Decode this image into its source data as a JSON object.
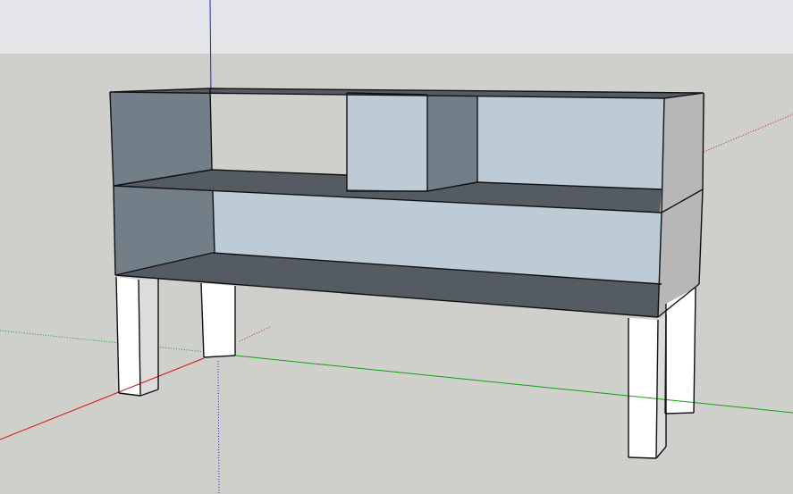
{
  "app": {
    "type": "3d-modeling-viewport",
    "view": "perspective"
  },
  "scene": {
    "object": "shelving-unit",
    "components": [
      "top-panel",
      "middle-shelf",
      "bottom-shelf",
      "back-panel",
      "left-side-panel",
      "right-side-panel",
      "center-cubby",
      "four-legs"
    ]
  },
  "colors": {
    "sky": "#e3e5e8",
    "ground": "#cfcfcb",
    "axis_red": "#d11616",
    "axis_green": "#12a012",
    "axis_blue": "#2323d6",
    "back_panel": "#bccbd5",
    "side_panel_dark": "#737f88",
    "shelf_surface": "#545b63",
    "side_panel_light": "#b7b7b7",
    "leg_front": "#ffffff",
    "leg_side": "#dcdcdc",
    "edge": "#111111"
  }
}
